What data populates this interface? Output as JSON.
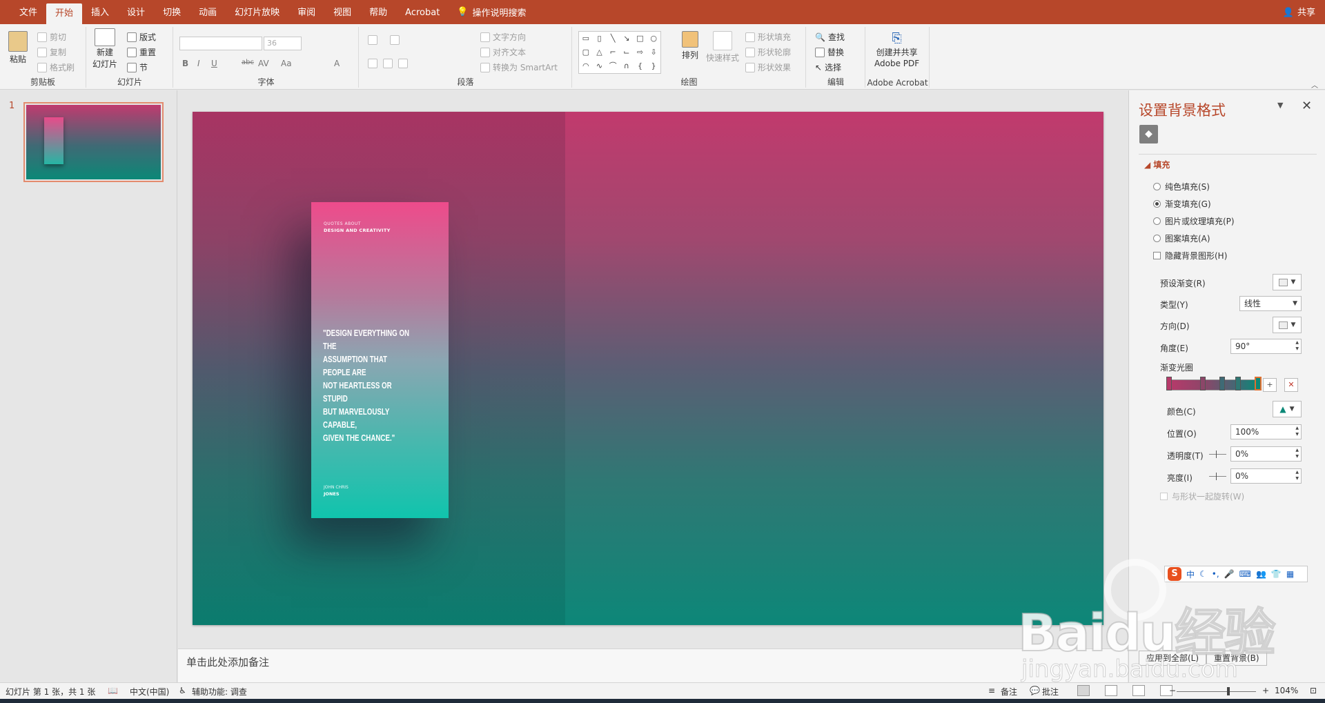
{
  "tabs": [
    "文件",
    "开始",
    "插入",
    "设计",
    "切换",
    "动画",
    "幻灯片放映",
    "审阅",
    "视图",
    "帮助",
    "Acrobat"
  ],
  "active_tab": "开始",
  "tell_me": "操作说明搜索",
  "share": "共享",
  "ribbon": {
    "clipboard": {
      "paste": "粘贴",
      "cut": "剪切",
      "copy": "复制",
      "format_painter": "格式刷",
      "label": "剪贴板"
    },
    "slides": {
      "new_slide": "新建",
      "new_slide_2": "幻灯片",
      "layout": "版式",
      "reset": "重置",
      "section": "节",
      "label": "幻灯片"
    },
    "font": {
      "size": "36",
      "label": "字体",
      "bold": "B",
      "italic": "I",
      "underline": "U",
      "strike": "abc",
      "spacing": "AV",
      "case": "Aa",
      "color": "A"
    },
    "paragraph": {
      "text_direction": "文字方向",
      "align_text": "对齐文本",
      "smartart": "转换为 SmartArt",
      "label": "段落"
    },
    "drawing": {
      "arrange": "排列",
      "quick_styles": "快速样式",
      "shape_fill": "形状填充",
      "shape_outline": "形状轮廓",
      "shape_effects": "形状效果",
      "label": "绘图"
    },
    "editing": {
      "find": "查找",
      "replace": "替换",
      "select": "选择",
      "label": "编辑"
    },
    "acrobat": {
      "create": "创建并共享",
      "pdf": "Adobe PDF",
      "label": "Adobe Acrobat"
    }
  },
  "thumbnail": {
    "number": "1"
  },
  "slide": {
    "card_top_1": "QUOTES ABOUT",
    "card_top_2": "DESIGN AND CREATIVITY",
    "quote": "\"DESIGN EVERYTHING ON THE\nASSUMPTION THAT PEOPLE ARE\nNOT HEARTLESS OR STUPID\nBUT MARVELOUSLY CAPABLE,\nGIVEN THE CHANCE.\"",
    "author_1": "JOHN CHRIS",
    "author_2": "JONES"
  },
  "notes_placeholder": "单击此处添加备注",
  "pane": {
    "title": "设置背景格式",
    "section": "填充",
    "options": [
      {
        "label": "纯色填充(S)",
        "selected": false
      },
      {
        "label": "渐变填充(G)",
        "selected": true
      },
      {
        "label": "图片或纹理填充(P)",
        "selected": false
      },
      {
        "label": "图案填充(A)",
        "selected": false
      }
    ],
    "hide_bg": "隐藏背景图形(H)",
    "preset": "预设渐变(R)",
    "type_label": "类型(Y)",
    "type_value": "线性",
    "direction": "方向(D)",
    "angle_label": "角度(E)",
    "angle_value": "90°",
    "stops_label": "渐变光圈",
    "color_label": "颜色(C)",
    "position_label": "位置(O)",
    "position_value": "100%",
    "transparency_label": "透明度(T)",
    "transparency_value": "0%",
    "brightness_label": "亮度(I)",
    "brightness_value": "0%",
    "rotate_with_shape": "与形状一起旋转(W)",
    "apply_all": "应用到全部(L)",
    "reset_bg": "重置背景(B)"
  },
  "gradient_stops": [
    {
      "position": 0,
      "color": "#b73a6a"
    },
    {
      "position": 0.38,
      "color": "#8c4669"
    },
    {
      "position": 0.6,
      "color": "#3f6a75"
    },
    {
      "position": 0.78,
      "color": "#2f7874"
    },
    {
      "position": 1.0,
      "color": "#0c8877",
      "selected": true
    }
  ],
  "ime": {
    "lang": "中"
  },
  "watermark": {
    "main": "Baidu经验",
    "sub": "jingyan.baidu.com"
  },
  "status": {
    "slide_info": "幻灯片 第 1 张，共 1 张",
    "language": "中文(中国)",
    "accessibility": "辅助功能: 调查",
    "notes": "备注",
    "comments": "批注",
    "zoom": "104%"
  },
  "colors": {
    "accent": "#b7472a"
  }
}
